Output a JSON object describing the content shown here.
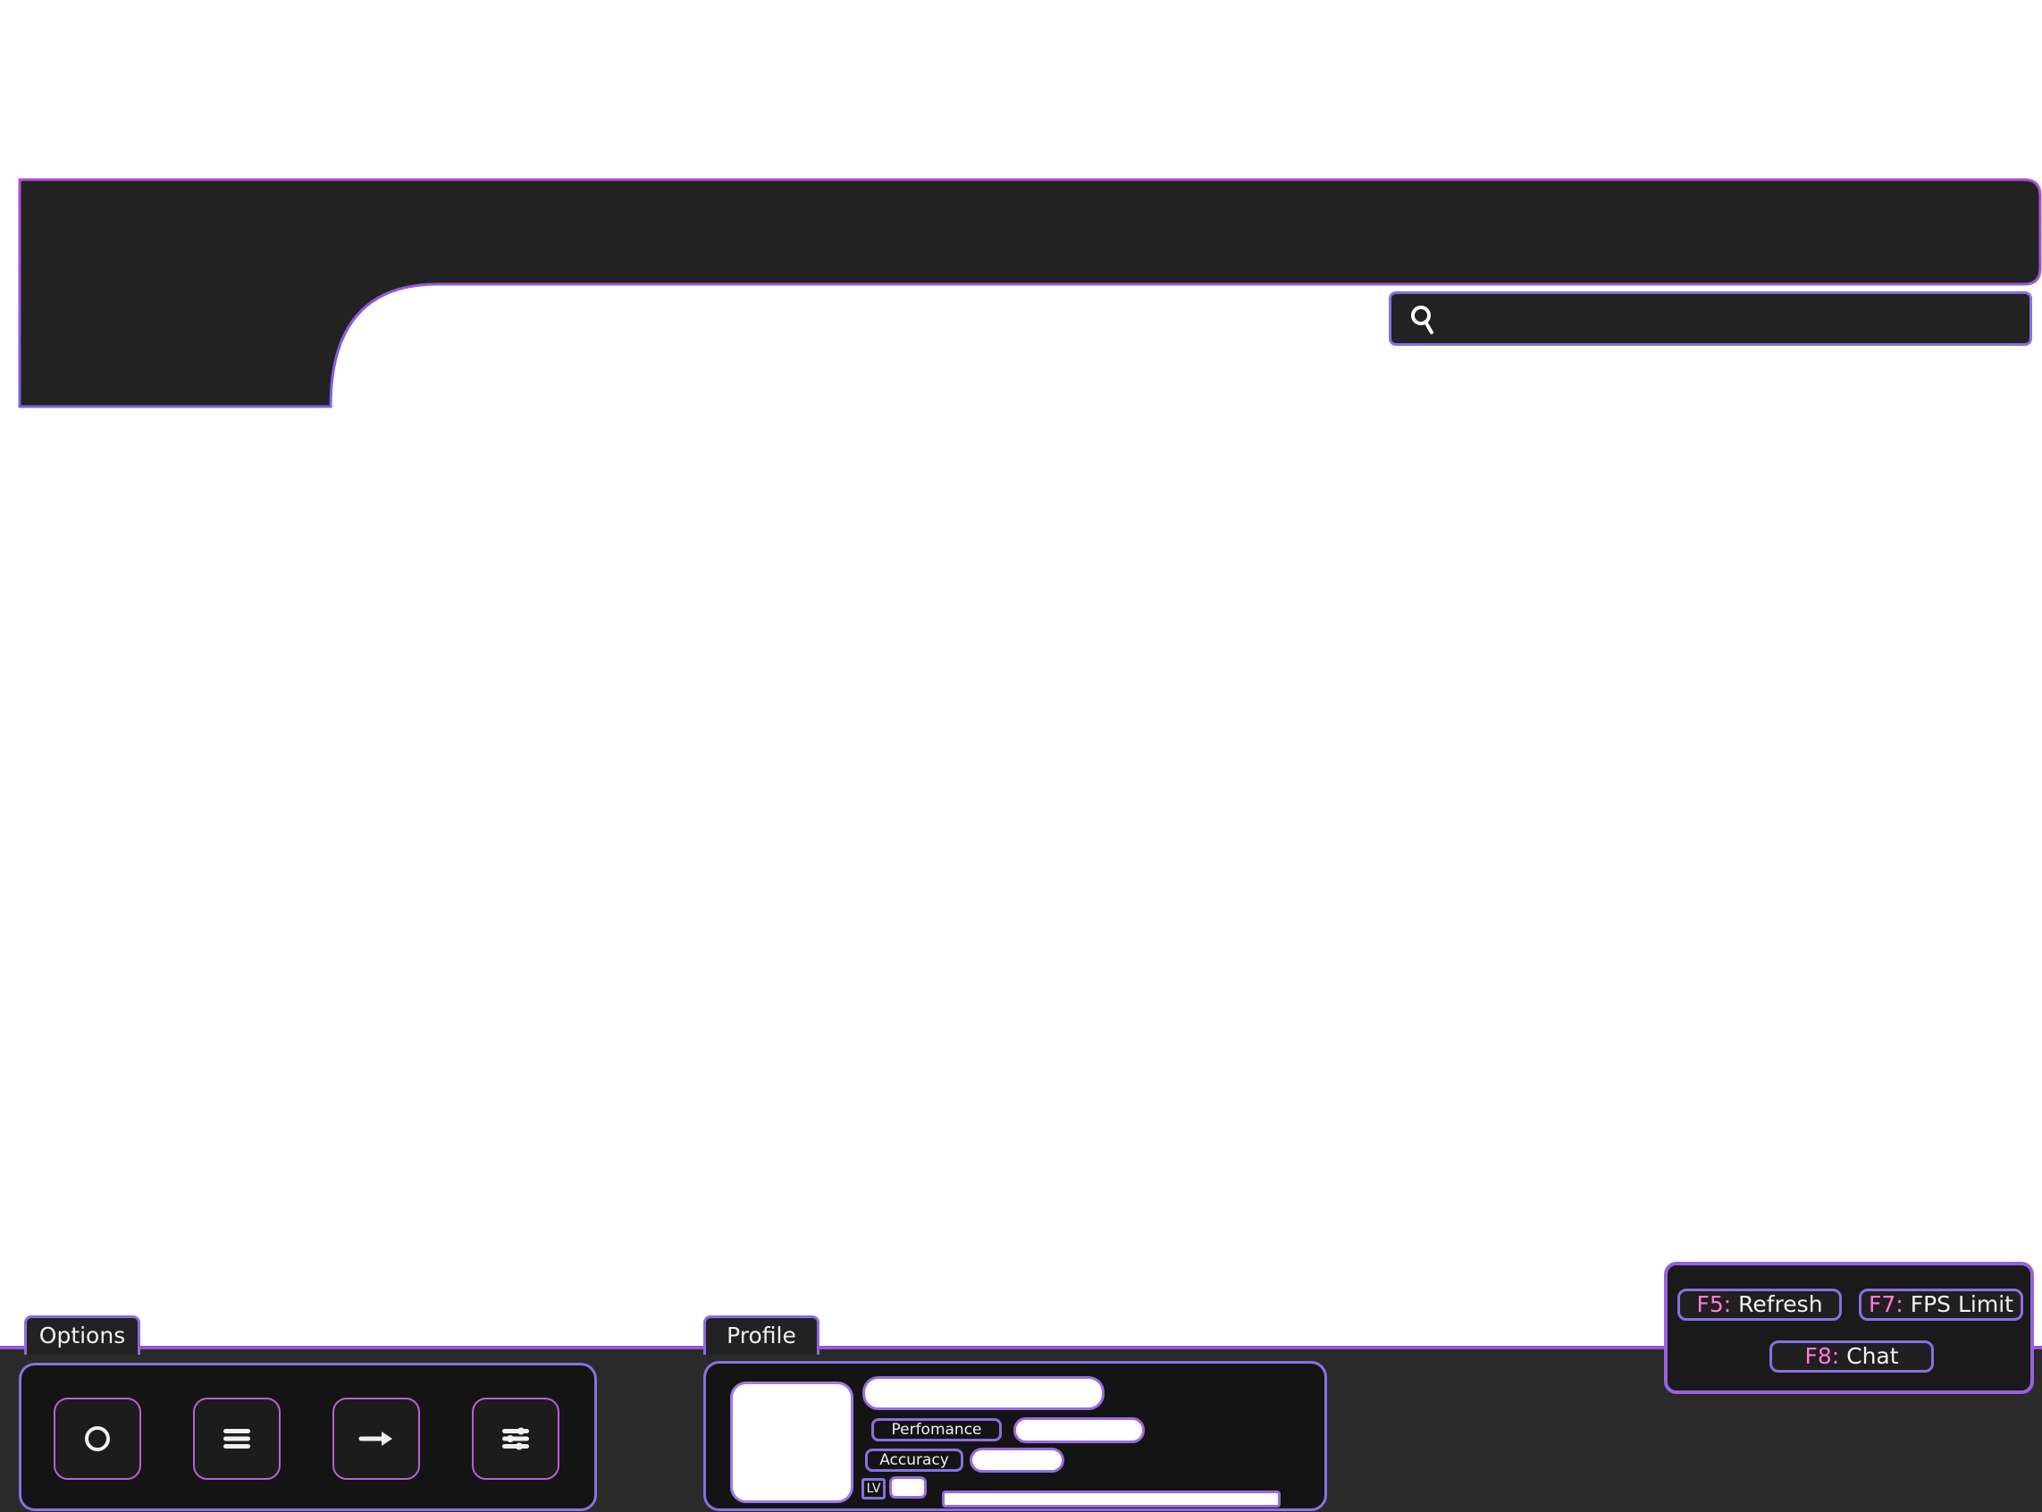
{
  "colors": {
    "panel_dark": "#222222",
    "panel_darker": "#141414",
    "border_purple": "#8a6fe0",
    "border_magenta": "#b95fd6",
    "key_accent": "#ff7ad9"
  },
  "header": {
    "search": {
      "icon": "search-icon",
      "placeholder": ""
    }
  },
  "options": {
    "tab_label": "Options",
    "buttons": [
      {
        "icon": "circle-icon"
      },
      {
        "icon": "menu-icon"
      },
      {
        "icon": "arrow-right-icon"
      },
      {
        "icon": "sliders-icon"
      }
    ]
  },
  "profile": {
    "tab_label": "Profile",
    "performance_label": "Perfomance",
    "accuracy_label": "Accuracy",
    "level_label": "LV"
  },
  "shortcuts": {
    "refresh": {
      "key": "F5",
      "sep": ":",
      "label": " Refresh"
    },
    "fps": {
      "key": "F7",
      "sep": ":",
      "label": " FPS Limit"
    },
    "chat": {
      "key": "F8",
      "sep": ":",
      "label": " Chat"
    }
  }
}
